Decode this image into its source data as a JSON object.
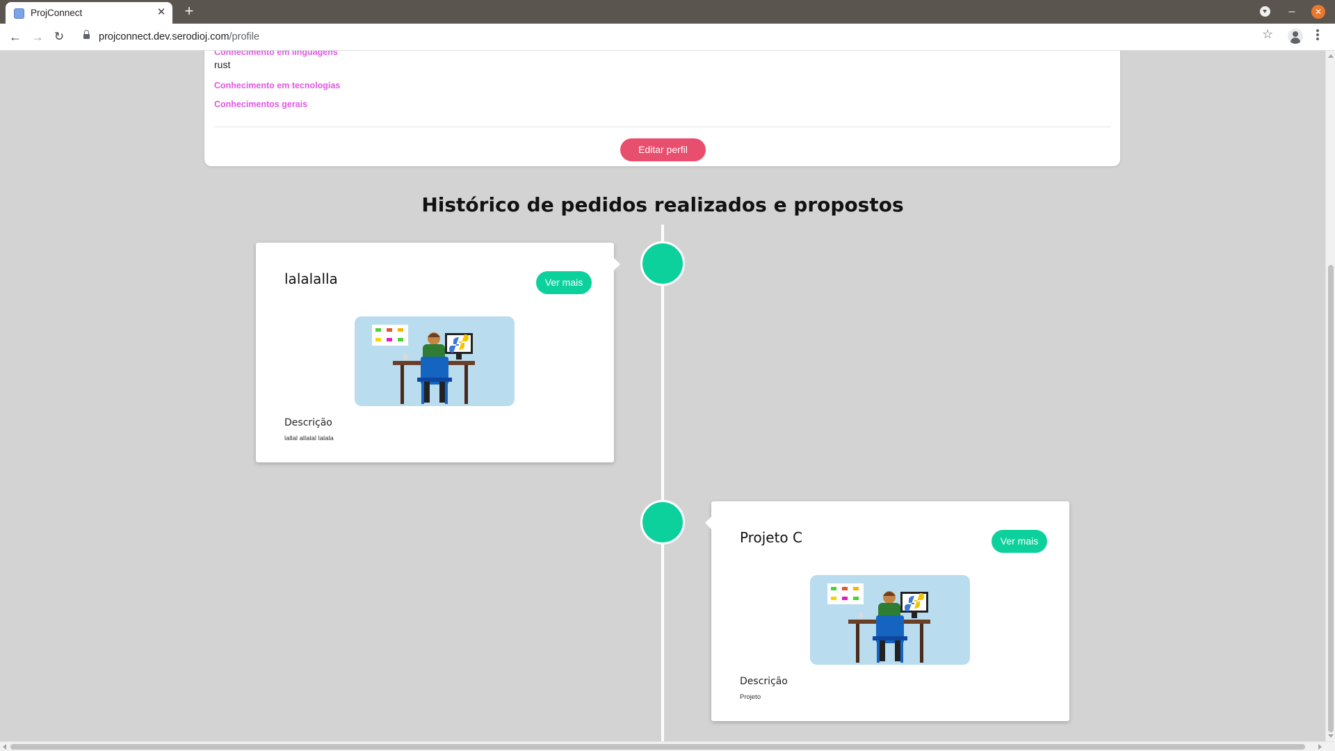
{
  "browser": {
    "tab_title": "ProjConnect",
    "tab_close": "✕",
    "new_tab": "+",
    "url_host": "projconnect.dev.serodioj.com",
    "url_path": "/profile",
    "icons": {
      "back": "arrow-left-icon",
      "forward": "arrow-right-icon",
      "reload": "reload-icon",
      "lock": "lock-icon",
      "star": "star-icon",
      "profile": "profile-icon",
      "menu": "kebab-menu-icon"
    }
  },
  "profile": {
    "languages_label": "Conhecimento em linguagens",
    "languages_value": "rust",
    "technologies_label": "Conhecimento em tecnologias",
    "general_label": "Conhecimentos gerais",
    "edit_button": "Editar perfil"
  },
  "history": {
    "title": "Histórico de pedidos realizados e propostos",
    "items": [
      {
        "title": "lalalalla",
        "button": "Ver mais",
        "desc_label": "Descrição",
        "desc_text": "lallal allalal lalala"
      },
      {
        "title": "Projeto C",
        "button": "Ver mais",
        "desc_label": "Descrição",
        "desc_text": "Projeto"
      }
    ]
  },
  "colors": {
    "accent_green": "#0dd19c",
    "accent_pink": "#e84e6e",
    "label_magenta": "#e157e3",
    "page_bg": "#d3d3d3"
  }
}
